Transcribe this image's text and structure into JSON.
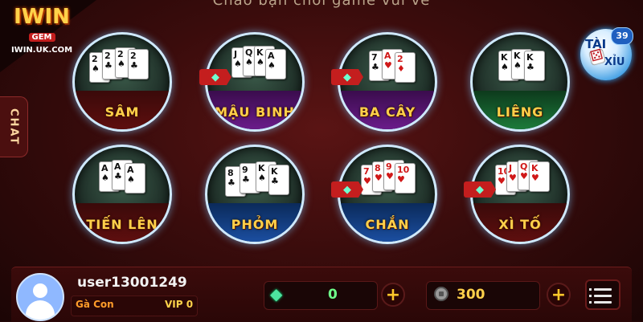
{
  "header": {
    "greeting": "Chào bạn chơi game vui vẻ"
  },
  "logo": {
    "main": "IWIN",
    "sub": "GEM",
    "url": "IWIN.UK.COM"
  },
  "chat_tab": {
    "label": "CHAT"
  },
  "taixiu": {
    "label_top": "TÀI",
    "label_bottom": "XỈU",
    "count": "39"
  },
  "games": [
    {
      "label": "SÂM",
      "felt": "red",
      "badge": false
    },
    {
      "label": "MẬU BINH",
      "felt": "purple",
      "badge": true
    },
    {
      "label": "BA CÂY",
      "felt": "purple",
      "badge": true
    },
    {
      "label": "LIÊNG",
      "felt": "green",
      "badge": false
    },
    {
      "label": "TIẾN LÊN",
      "felt": "red",
      "badge": false
    },
    {
      "label": "PHỎM",
      "felt": "blue",
      "badge": false
    },
    {
      "label": "CHẮN",
      "felt": "blue",
      "badge": true
    },
    {
      "label": "XÌ TỐ",
      "felt": "red",
      "badge": true
    }
  ],
  "user": {
    "name": "user13001249",
    "rank": "Gà Con",
    "vip": "VIP 0"
  },
  "wallet": {
    "gems": "0",
    "chips": "300"
  },
  "icons": {
    "gem": "gem-icon",
    "chip": "chip-icon",
    "menu": "menu-icon",
    "avatar": "user-avatar-icon",
    "plus": "plus-icon"
  },
  "colors": {
    "accent_gold": "#ffd04a",
    "brand_red": "#c41e1e",
    "gem_green": "#4de3a0"
  }
}
